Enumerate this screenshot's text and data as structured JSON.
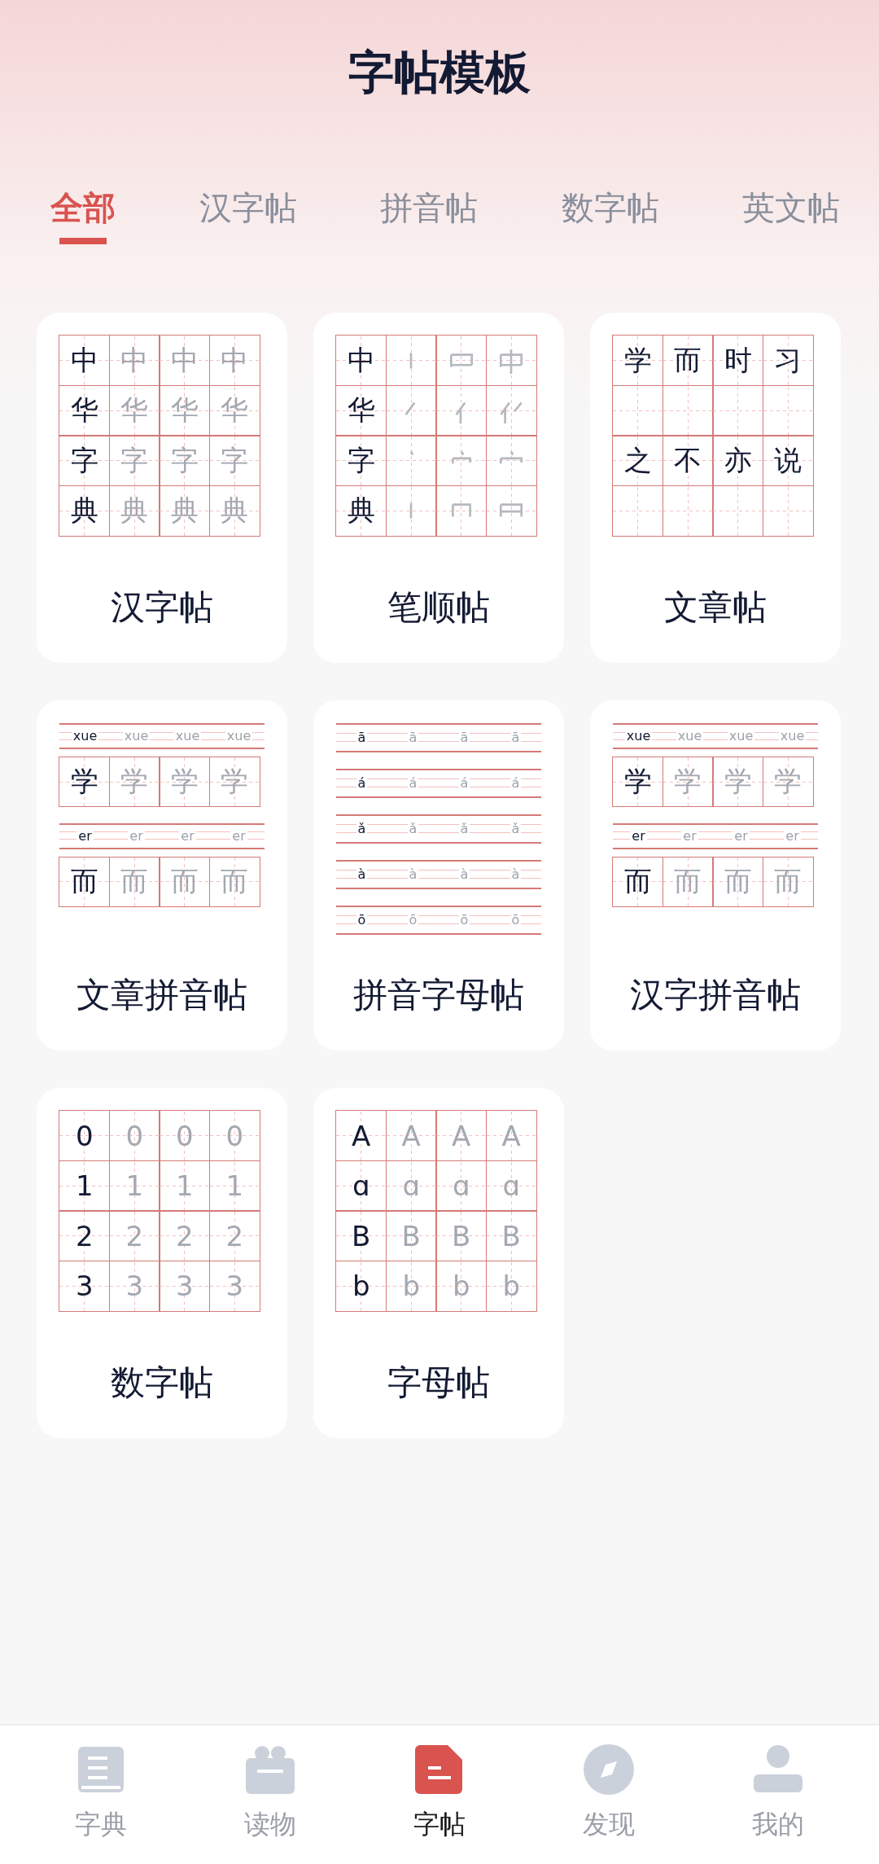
{
  "header": {
    "title": "字帖模板"
  },
  "tabs": [
    {
      "label": "全部",
      "selected": true
    },
    {
      "label": "汉字帖",
      "selected": false
    },
    {
      "label": "拼音帖",
      "selected": false
    },
    {
      "label": "数字帖",
      "selected": false
    },
    {
      "label": "英文帖",
      "selected": false
    }
  ],
  "cards": [
    {
      "title": "汉字帖",
      "kind": "grid",
      "rows": [
        [
          "中",
          "中",
          "中",
          "中"
        ],
        [
          "华",
          "华",
          "华",
          "华"
        ],
        [
          "字",
          "字",
          "字",
          "字"
        ],
        [
          "典",
          "典",
          "典",
          "典"
        ]
      ]
    },
    {
      "title": "笔顺帖",
      "kind": "strokes",
      "rows": [
        "中",
        "华",
        "字",
        "典"
      ]
    },
    {
      "title": "文章帖",
      "kind": "article",
      "lines": [
        [
          "学",
          "而",
          "时",
          "习"
        ],
        [
          "之",
          "不",
          "亦",
          "说"
        ]
      ]
    },
    {
      "title": "文章拼音帖",
      "kind": "pinyin",
      "blocks": [
        {
          "pinyin": [
            "xue",
            "xue",
            "xue",
            "xue"
          ],
          "chars": [
            "学",
            "学",
            "学",
            "学"
          ]
        },
        {
          "pinyin": [
            "er",
            "er",
            "er",
            "er"
          ],
          "chars": [
            "而",
            "而",
            "而",
            "而"
          ]
        }
      ]
    },
    {
      "title": "拼音字母帖",
      "kind": "letters",
      "rows": [
        [
          "ā",
          "ā",
          "ā",
          "ā"
        ],
        [
          "á",
          "á",
          "á",
          "á"
        ],
        [
          "ǎ",
          "ǎ",
          "ǎ",
          "ǎ"
        ],
        [
          "à",
          "à",
          "à",
          "à"
        ],
        [
          "ō",
          "ō",
          "ō",
          "ō"
        ]
      ]
    },
    {
      "title": "汉字拼音帖",
      "kind": "pinyin",
      "blocks": [
        {
          "pinyin": [
            "xue",
            "xue",
            "xue",
            "xue"
          ],
          "chars": [
            "学",
            "学",
            "学",
            "学"
          ]
        },
        {
          "pinyin": [
            "er",
            "er",
            "er",
            "er"
          ],
          "chars": [
            "而",
            "而",
            "而",
            "而"
          ]
        }
      ]
    },
    {
      "title": "数字帖",
      "kind": "grid",
      "rows": [
        [
          "0",
          "0",
          "0",
          "0"
        ],
        [
          "1",
          "1",
          "1",
          "1"
        ],
        [
          "2",
          "2",
          "2",
          "2"
        ],
        [
          "3",
          "3",
          "3",
          "3"
        ]
      ]
    },
    {
      "title": "字母帖",
      "kind": "grid",
      "rows": [
        [
          "A",
          "A",
          "A",
          "A"
        ],
        [
          "ɑ",
          "ɑ",
          "ɑ",
          "ɑ"
        ],
        [
          "B",
          "B",
          "B",
          "B"
        ],
        [
          "b",
          "b",
          "b",
          "b"
        ]
      ]
    }
  ],
  "nav": [
    {
      "label": "字典",
      "selected": false
    },
    {
      "label": "读物",
      "selected": false
    },
    {
      "label": "字帖",
      "selected": true
    },
    {
      "label": "发现",
      "selected": false
    },
    {
      "label": "我的",
      "selected": false
    }
  ]
}
